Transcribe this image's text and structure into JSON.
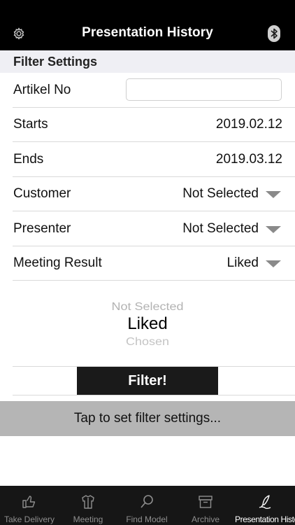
{
  "header": {
    "title": "Presentation History",
    "settings_icon": "gear-icon",
    "bluetooth_icon": "bluetooth-icon"
  },
  "filter": {
    "section_title": "Filter Settings",
    "artikel": {
      "label": "Artikel No",
      "value": "",
      "placeholder": ""
    },
    "starts": {
      "label": "Starts",
      "value": "2019.02.12"
    },
    "ends": {
      "label": "Ends",
      "value": "2019.03.12"
    },
    "customer": {
      "label": "Customer",
      "value": "Not Selected"
    },
    "presenter": {
      "label": "Presenter",
      "value": "Not Selected"
    },
    "meeting_result": {
      "label": "Meeting Result",
      "value": "Liked"
    }
  },
  "picker": {
    "options": [
      "Not Selected",
      "Liked",
      "Chosen"
    ],
    "selected": "Liked"
  },
  "filter_button": "Filter!",
  "status_text": "Tap to set filter settings...",
  "tabs": [
    {
      "label": "Take Delivery",
      "icon": "thumbs-up-icon",
      "active": false
    },
    {
      "label": "Meeting",
      "icon": "shirt-icon",
      "active": false
    },
    {
      "label": "Find Model",
      "icon": "search-icon",
      "active": false
    },
    {
      "label": "Archive",
      "icon": "archive-box-icon",
      "active": false
    },
    {
      "label": "Presentation History",
      "icon": "quill-pen-icon",
      "active": true
    }
  ],
  "colors": {
    "header_bg": "#000000",
    "section_bg": "#efeff4",
    "button_bg": "#1a1a1a",
    "status_bar_bg": "#b5b5b5",
    "tabbar_bg": "#161616",
    "tab_inactive": "#8e8e8e",
    "tab_active": "#ffffff"
  }
}
